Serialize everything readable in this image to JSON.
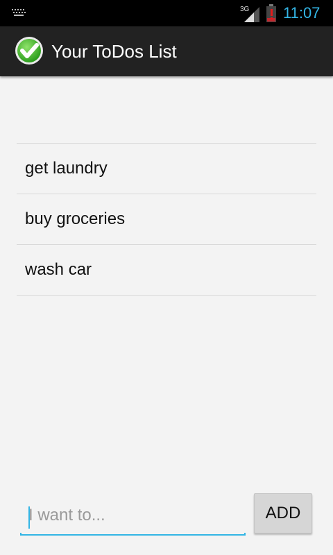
{
  "status_bar": {
    "time": "11:07",
    "network_label": "3G",
    "icons": [
      "keyboard-icon",
      "signal-3g-icon",
      "battery-alert-icon"
    ],
    "accent_color": "#33b5e5"
  },
  "action_bar": {
    "title": "Your ToDos List",
    "icon": "checkmark-icon",
    "background": "#222222"
  },
  "todos": [
    {
      "label": "get laundry"
    },
    {
      "label": "buy groceries"
    },
    {
      "label": "wash car"
    }
  ],
  "input": {
    "value": "",
    "placeholder": "I want to..."
  },
  "add_button": {
    "label": "ADD"
  }
}
